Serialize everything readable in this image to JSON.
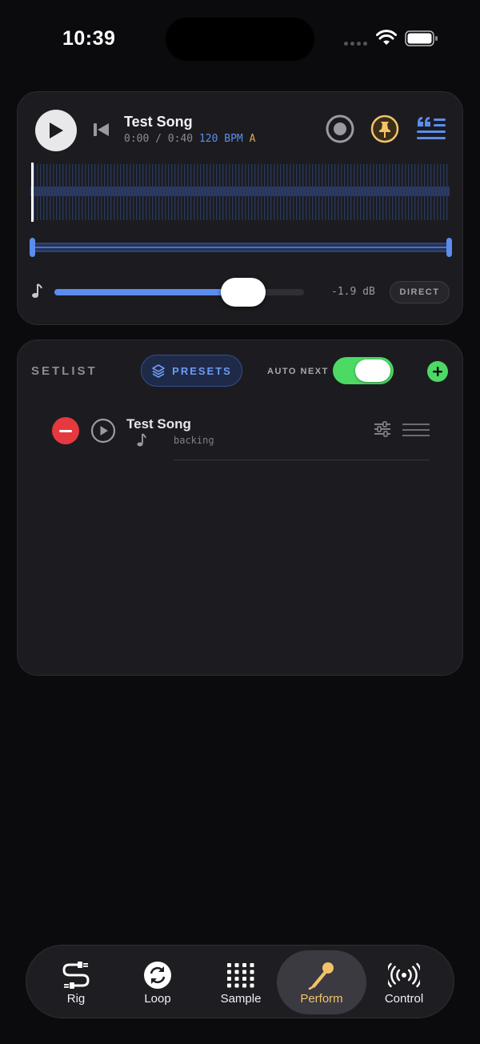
{
  "status_bar": {
    "time": "10:39"
  },
  "player": {
    "song_title": "Test Song",
    "position": "0:00",
    "separator": "/",
    "duration": "0:40",
    "bpm": "120 BPM",
    "key": "A",
    "volume_fraction": 0.73,
    "volume_db": "-1.9 dB",
    "direct_label": "DIRECT",
    "accent_color": "#5b8dee",
    "pin_color": "#f2c26b"
  },
  "setlist": {
    "title": "SETLIST",
    "presets_label": "PRESETS",
    "auto_next_label": "AUTO NEXT",
    "auto_next_on": true,
    "items": [
      {
        "title": "Test Song",
        "subtitle": "backing"
      }
    ]
  },
  "tabs": [
    {
      "label": "Rig",
      "icon": "cable-icon",
      "active": false
    },
    {
      "label": "Loop",
      "icon": "loop-icon",
      "active": false
    },
    {
      "label": "Sample",
      "icon": "grid-icon",
      "active": false
    },
    {
      "label": "Perform",
      "icon": "microphone-icon",
      "active": true
    },
    {
      "label": "Control",
      "icon": "broadcast-icon",
      "active": false
    }
  ]
}
